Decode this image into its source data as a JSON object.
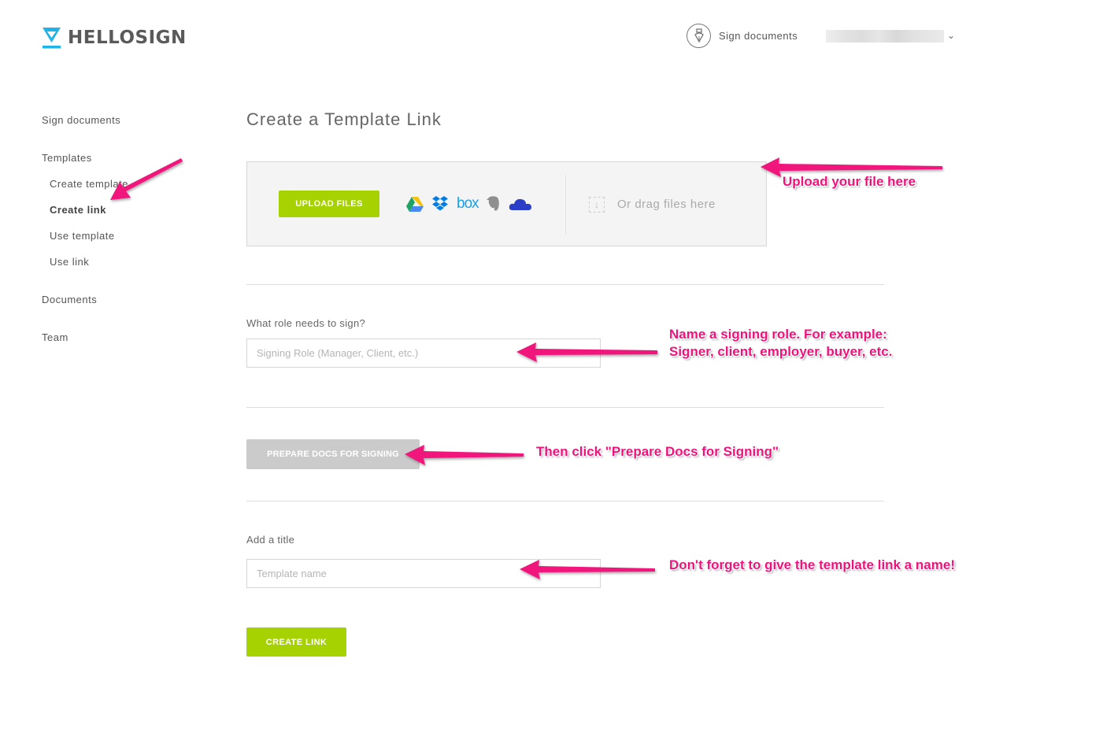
{
  "header": {
    "logo_text": "HELLOSIGN",
    "sign_documents": "Sign documents",
    "user_menu_chevron": "⌄"
  },
  "sidebar": {
    "items": [
      {
        "label": "Sign documents"
      },
      {
        "label": "Templates"
      },
      {
        "label": "Create template"
      },
      {
        "label": "Create link",
        "active": true
      },
      {
        "label": "Use template"
      },
      {
        "label": "Use link"
      },
      {
        "label": "Documents"
      },
      {
        "label": "Team"
      }
    ]
  },
  "main": {
    "title": "Create a Template Link",
    "upload": {
      "button_label": "UPLOAD FILES",
      "integrations": [
        "google-drive",
        "dropbox",
        "box",
        "evernote",
        "onedrive"
      ],
      "box_text": "box",
      "drag_label": "Or drag files here"
    },
    "role": {
      "label": "What role needs to sign?",
      "placeholder": "Signing Role (Manager, Client, etc.)",
      "value": ""
    },
    "prepare_button": "PREPARE DOCS FOR SIGNING",
    "title_field": {
      "label": "Add a title",
      "placeholder": "Template name",
      "value": ""
    },
    "create_button": "CREATE LINK"
  },
  "annotations": {
    "upload": "Upload your file here",
    "role_line1": "Name a signing role. For example:",
    "role_line2": "Signer, client, employer, buyer, etc.",
    "prepare": "Then click \"Prepare Docs for Signing\"",
    "title": "Don't forget to give the template link a name!"
  },
  "colors": {
    "brand_blue": "#1fb3e8",
    "accent_green": "#a5d200",
    "annotation_pink": "#f0127b",
    "disabled_gray": "#cbcbcb"
  }
}
